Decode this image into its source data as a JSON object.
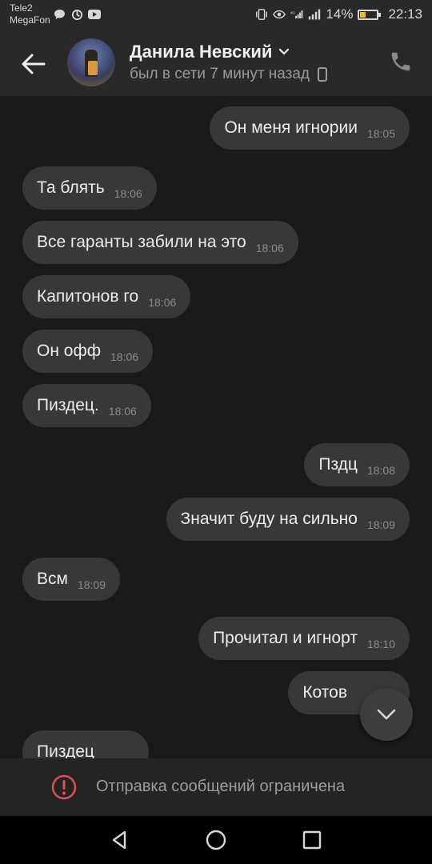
{
  "status_bar": {
    "carrier1": "Tele2",
    "carrier2": "MegaFon",
    "battery_percent": "14%",
    "battery_level": 0.14,
    "time": "22:13"
  },
  "header": {
    "contact_name": "Данила Невский",
    "last_seen": "был в сети 7 минут назад"
  },
  "messages": [
    {
      "dir": "out",
      "text": "Он меня игнории",
      "time": "18:05"
    },
    {
      "dir": "in",
      "text": "Та блять",
      "time": "18:06"
    },
    {
      "dir": "in",
      "text": "Все гаранты забили на это",
      "time": "18:06"
    },
    {
      "dir": "in",
      "text": "Капитонов го",
      "time": "18:06"
    },
    {
      "dir": "in",
      "text": "Он офф",
      "time": "18:06"
    },
    {
      "dir": "in",
      "text": "Пиздец.",
      "time": "18:06"
    },
    {
      "dir": "out",
      "text": "Пздц",
      "time": "18:08"
    },
    {
      "dir": "out",
      "text": "Значит буду на сильно",
      "time": "18:09"
    },
    {
      "dir": "in",
      "text": "Всм",
      "time": "18:09"
    },
    {
      "dir": "out",
      "text": "Прочитал и игнорт",
      "time": "18:10"
    },
    {
      "dir": "out",
      "text": "Котов",
      "time": ""
    },
    {
      "dir": "in",
      "text": "Пиздец",
      "time": ""
    }
  ],
  "restriction": {
    "label": "Отправка сообщений ограничена"
  },
  "colors": {
    "bubble": "#383838",
    "background": "#1a1a1a",
    "header": "#292929",
    "alert": "#e0504f"
  }
}
